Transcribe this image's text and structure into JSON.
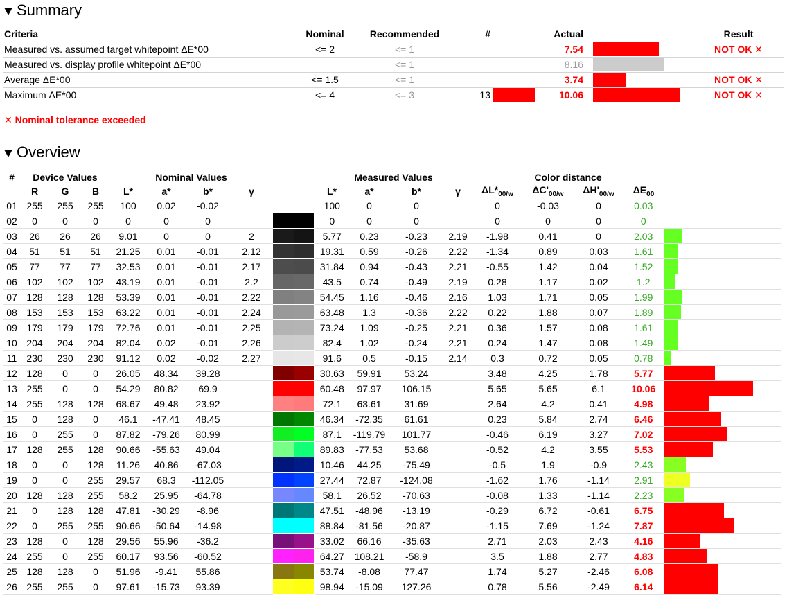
{
  "summary": {
    "title": "Summary",
    "headers": {
      "criteria": "Criteria",
      "nominal": "Nominal",
      "recommended": "Recommended",
      "count": "#",
      "actual": "Actual",
      "result": "Result"
    },
    "rows": [
      {
        "criteria": "Measured vs. assumed target whitepoint ΔE*00",
        "nominal": "<= 2",
        "recommended": "<= 1",
        "count": "",
        "count_bar": 0,
        "actual": "7.54",
        "actual_style": "red",
        "actual_bar": 0.75,
        "result": "NOT OK ✕"
      },
      {
        "criteria": "Measured vs. display profile whitepoint ΔE*00",
        "nominal": "",
        "recommended": "<= 1",
        "count": "",
        "count_bar": 0,
        "actual": "8.16",
        "actual_style": "grey",
        "actual_bar": 0.81,
        "result": ""
      },
      {
        "criteria": "Average ΔE*00",
        "nominal": "<= 1.5",
        "recommended": "<= 1",
        "count": "",
        "count_bar": 0,
        "actual": "3.74",
        "actual_style": "red",
        "actual_bar": 0.37,
        "result": "NOT OK ✕"
      },
      {
        "criteria": "Maximum ΔE*00",
        "nominal": "<= 4",
        "recommended": "<= 3",
        "count": "13",
        "count_bar": 1,
        "actual": "10.06",
        "actual_style": "red",
        "actual_bar": 1.0,
        "result": "NOT OK ✕"
      }
    ],
    "tolerance_message": "✕ Nominal tolerance exceeded"
  },
  "overview": {
    "title": "Overview",
    "group_headers": {
      "num": "#",
      "device": "Device Values",
      "nominal": "Nominal Values",
      "measured": "Measured Values",
      "distance": "Color distance"
    },
    "col_headers": {
      "R": "R",
      "G": "G",
      "B": "B",
      "L": "L*",
      "a": "a*",
      "b": "b*",
      "gamma": "γ",
      "mL": "L*",
      "ma": "a*",
      "mb": "b*",
      "mgamma": "γ",
      "dL": "ΔL*",
      "dC": "ΔC'",
      "dH": "ΔH'",
      "dE": "ΔE",
      "sub_w": "00/w",
      "sub_00": "00"
    },
    "rows": [
      {
        "n": "01",
        "R": "255",
        "G": "255",
        "B": "255",
        "L": "100",
        "a": "0.02",
        "b": "-0.02",
        "g": "",
        "nom": "#ffffff",
        "meas": "#ffffff",
        "mL": "100",
        "ma": "0",
        "mb": "0",
        "mg": "",
        "dL": "0",
        "dC": "-0.03",
        "dH": "0",
        "dE": "0.03",
        "bad": false,
        "bar": 0.003,
        "barcolor": "#66ff22"
      },
      {
        "n": "02",
        "R": "0",
        "G": "0",
        "B": "0",
        "L": "0",
        "a": "0",
        "b": "0",
        "g": "",
        "nom": "#000000",
        "meas": "#000000",
        "mL": "0",
        "ma": "0",
        "mb": "0",
        "mg": "",
        "dL": "0",
        "dC": "0",
        "dH": "0",
        "dE": "0",
        "bad": false,
        "bar": 0,
        "barcolor": "#66ff22"
      },
      {
        "n": "03",
        "R": "26",
        "G": "26",
        "B": "26",
        "L": "9.01",
        "a": "0",
        "b": "0",
        "g": "2",
        "nom": "#1a1a1a",
        "meas": "#141414",
        "mL": "5.77",
        "ma": "0.23",
        "mb": "-0.23",
        "mg": "2.19",
        "dL": "-1.98",
        "dC": "0.41",
        "dH": "0",
        "dE": "2.03",
        "bad": false,
        "bar": 0.2,
        "barcolor": "#66ff22"
      },
      {
        "n": "04",
        "R": "51",
        "G": "51",
        "B": "51",
        "L": "21.25",
        "a": "0.01",
        "b": "-0.01",
        "g": "2.12",
        "nom": "#333333",
        "meas": "#2e2e2e",
        "mL": "19.31",
        "ma": "0.59",
        "mb": "-0.26",
        "mg": "2.22",
        "dL": "-1.34",
        "dC": "0.89",
        "dH": "0.03",
        "dE": "1.61",
        "bad": false,
        "bar": 0.16,
        "barcolor": "#66ff22"
      },
      {
        "n": "05",
        "R": "77",
        "G": "77",
        "B": "77",
        "L": "32.53",
        "a": "0.01",
        "b": "-0.01",
        "g": "2.17",
        "nom": "#4d4d4d",
        "meas": "#4b4b4b",
        "mL": "31.84",
        "ma": "0.94",
        "mb": "-0.43",
        "mg": "2.21",
        "dL": "-0.55",
        "dC": "1.42",
        "dH": "0.04",
        "dE": "1.52",
        "bad": false,
        "bar": 0.15,
        "barcolor": "#66ff22"
      },
      {
        "n": "06",
        "R": "102",
        "G": "102",
        "B": "102",
        "L": "43.19",
        "a": "0.01",
        "b": "-0.01",
        "g": "2.2",
        "nom": "#666666",
        "meas": "#686868",
        "mL": "43.5",
        "ma": "0.74",
        "mb": "-0.49",
        "mg": "2.19",
        "dL": "0.28",
        "dC": "1.17",
        "dH": "0.02",
        "dE": "1.2",
        "bad": false,
        "bar": 0.12,
        "barcolor": "#66ff22"
      },
      {
        "n": "07",
        "R": "128",
        "G": "128",
        "B": "128",
        "L": "53.39",
        "a": "0.01",
        "b": "-0.01",
        "g": "2.22",
        "nom": "#808080",
        "meas": "#838383",
        "mL": "54.45",
        "ma": "1.16",
        "mb": "-0.46",
        "mg": "2.16",
        "dL": "1.03",
        "dC": "1.71",
        "dH": "0.05",
        "dE": "1.99",
        "bad": false,
        "bar": 0.2,
        "barcolor": "#66ff22"
      },
      {
        "n": "08",
        "R": "153",
        "G": "153",
        "B": "153",
        "L": "63.22",
        "a": "0.01",
        "b": "-0.01",
        "g": "2.24",
        "nom": "#999999",
        "meas": "#9a9a9a",
        "mL": "63.48",
        "ma": "1.3",
        "mb": "-0.36",
        "mg": "2.22",
        "dL": "0.22",
        "dC": "1.88",
        "dH": "0.07",
        "dE": "1.89",
        "bad": false,
        "bar": 0.19,
        "barcolor": "#66ff22"
      },
      {
        "n": "09",
        "R": "179",
        "G": "179",
        "B": "179",
        "L": "72.76",
        "a": "0.01",
        "b": "-0.01",
        "g": "2.25",
        "nom": "#b3b3b3",
        "meas": "#b4b4b4",
        "mL": "73.24",
        "ma": "1.09",
        "mb": "-0.25",
        "mg": "2.21",
        "dL": "0.36",
        "dC": "1.57",
        "dH": "0.08",
        "dE": "1.61",
        "bad": false,
        "bar": 0.16,
        "barcolor": "#66ff22"
      },
      {
        "n": "10",
        "R": "204",
        "G": "204",
        "B": "204",
        "L": "82.04",
        "a": "0.02",
        "b": "-0.01",
        "g": "2.26",
        "nom": "#cccccc",
        "meas": "#cdcdcd",
        "mL": "82.4",
        "ma": "1.02",
        "mb": "-0.24",
        "mg": "2.21",
        "dL": "0.24",
        "dC": "1.47",
        "dH": "0.08",
        "dE": "1.49",
        "bad": false,
        "bar": 0.15,
        "barcolor": "#66ff22"
      },
      {
        "n": "11",
        "R": "230",
        "G": "230",
        "B": "230",
        "L": "91.12",
        "a": "0.02",
        "b": "-0.02",
        "g": "2.27",
        "nom": "#e6e6e6",
        "meas": "#e7e7e7",
        "mL": "91.6",
        "ma": "0.5",
        "mb": "-0.15",
        "mg": "2.14",
        "dL": "0.3",
        "dC": "0.72",
        "dH": "0.05",
        "dE": "0.78",
        "bad": false,
        "bar": 0.08,
        "barcolor": "#66ff22"
      },
      {
        "n": "12",
        "R": "128",
        "G": "0",
        "B": "0",
        "L": "26.05",
        "a": "48.34",
        "b": "39.28",
        "g": "",
        "nom": "#800000",
        "meas": "#990000",
        "mL": "30.63",
        "ma": "59.91",
        "mb": "53.24",
        "mg": "",
        "dL": "3.48",
        "dC": "4.25",
        "dH": "1.78",
        "dE": "5.77",
        "bad": true,
        "bar": 0.57,
        "barcolor": "#ff0000"
      },
      {
        "n": "13",
        "R": "255",
        "G": "0",
        "B": "0",
        "L": "54.29",
        "a": "80.82",
        "b": "69.9",
        "g": "",
        "nom": "#ff0000",
        "meas": "#ff0000",
        "mL": "60.48",
        "ma": "97.97",
        "mb": "106.15",
        "mg": "",
        "dL": "5.65",
        "dC": "5.65",
        "dH": "6.1",
        "dE": "10.06",
        "bad": true,
        "bar": 1.0,
        "barcolor": "#ff0000"
      },
      {
        "n": "14",
        "R": "255",
        "G": "128",
        "B": "128",
        "L": "68.67",
        "a": "49.48",
        "b": "23.92",
        "g": "",
        "nom": "#ff8080",
        "meas": "#ff7a7a",
        "mL": "72.1",
        "ma": "63.61",
        "mb": "31.69",
        "mg": "",
        "dL": "2.64",
        "dC": "4.2",
        "dH": "0.41",
        "dE": "4.98",
        "bad": true,
        "bar": 0.5,
        "barcolor": "#ff0000"
      },
      {
        "n": "15",
        "R": "0",
        "G": "128",
        "B": "0",
        "L": "46.1",
        "a": "-47.41",
        "b": "48.45",
        "g": "",
        "nom": "#007700",
        "meas": "#008800",
        "mL": "46.34",
        "ma": "-72.35",
        "mb": "61.61",
        "mg": "",
        "dL": "0.23",
        "dC": "5.84",
        "dH": "2.74",
        "dE": "6.46",
        "bad": true,
        "bar": 0.64,
        "barcolor": "#ff0000"
      },
      {
        "n": "16",
        "R": "0",
        "G": "255",
        "B": "0",
        "L": "87.82",
        "a": "-79.26",
        "b": "80.99",
        "g": "",
        "nom": "#11ee22",
        "meas": "#00ff22",
        "mL": "87.1",
        "ma": "-119.79",
        "mb": "101.77",
        "mg": "",
        "dL": "-0.46",
        "dC": "6.19",
        "dH": "3.27",
        "dE": "7.02",
        "bad": true,
        "bar": 0.7,
        "barcolor": "#ff0000"
      },
      {
        "n": "17",
        "R": "128",
        "G": "255",
        "B": "128",
        "L": "90.66",
        "a": "-55.63",
        "b": "49.04",
        "g": "",
        "nom": "#77ff88",
        "meas": "#11ff77",
        "mL": "89.83",
        "ma": "-77.53",
        "mb": "53.68",
        "mg": "",
        "dL": "-0.52",
        "dC": "4.2",
        "dH": "3.55",
        "dE": "5.53",
        "bad": true,
        "bar": 0.55,
        "barcolor": "#ff0000"
      },
      {
        "n": "18",
        "R": "0",
        "G": "0",
        "B": "128",
        "L": "11.26",
        "a": "40.86",
        "b": "-67.03",
        "g": "",
        "nom": "#00167a",
        "meas": "#001a88",
        "mL": "10.46",
        "ma": "44.25",
        "mb": "-75.49",
        "mg": "",
        "dL": "-0.5",
        "dC": "1.9",
        "dH": "-0.9",
        "dE": "2.43",
        "bad": false,
        "bar": 0.24,
        "barcolor": "#88ff22"
      },
      {
        "n": "19",
        "R": "0",
        "G": "0",
        "B": "255",
        "L": "29.57",
        "a": "68.3",
        "b": "-112.05",
        "g": "",
        "nom": "#0033ff",
        "meas": "#0044ff",
        "mL": "27.44",
        "ma": "72.87",
        "mb": "-124.08",
        "mg": "",
        "dL": "-1.62",
        "dC": "1.76",
        "dH": "-1.14",
        "dE": "2.91",
        "bad": false,
        "bar": 0.29,
        "barcolor": "#eeff22"
      },
      {
        "n": "20",
        "R": "128",
        "G": "128",
        "B": "255",
        "L": "58.2",
        "a": "25.95",
        "b": "-64.78",
        "g": "",
        "nom": "#7788ff",
        "meas": "#6688ff",
        "mL": "58.1",
        "ma": "26.52",
        "mb": "-70.63",
        "mg": "",
        "dL": "-0.08",
        "dC": "1.33",
        "dH": "-1.14",
        "dE": "2.23",
        "bad": false,
        "bar": 0.22,
        "barcolor": "#88ff22"
      },
      {
        "n": "21",
        "R": "0",
        "G": "128",
        "B": "128",
        "L": "47.81",
        "a": "-30.29",
        "b": "-8.96",
        "g": "",
        "nom": "#007777",
        "meas": "#008888",
        "mL": "47.51",
        "ma": "-48.96",
        "mb": "-13.19",
        "mg": "",
        "dL": "-0.29",
        "dC": "6.72",
        "dH": "-0.61",
        "dE": "6.75",
        "bad": true,
        "bar": 0.67,
        "barcolor": "#ff0000"
      },
      {
        "n": "22",
        "R": "0",
        "G": "255",
        "B": "255",
        "L": "90.66",
        "a": "-50.64",
        "b": "-14.98",
        "g": "",
        "nom": "#00ffff",
        "meas": "#00ffff",
        "mL": "88.84",
        "ma": "-81.56",
        "mb": "-20.87",
        "mg": "",
        "dL": "-1.15",
        "dC": "7.69",
        "dH": "-1.24",
        "dE": "7.87",
        "bad": true,
        "bar": 0.78,
        "barcolor": "#ff0000"
      },
      {
        "n": "23",
        "R": "128",
        "G": "0",
        "B": "128",
        "L": "29.56",
        "a": "55.96",
        "b": "-36.2",
        "g": "",
        "nom": "#771177",
        "meas": "#991188",
        "mL": "33.02",
        "ma": "66.16",
        "mb": "-35.63",
        "mg": "",
        "dL": "2.71",
        "dC": "2.03",
        "dH": "2.43",
        "dE": "4.16",
        "bad": true,
        "bar": 0.41,
        "barcolor": "#ff0000"
      },
      {
        "n": "24",
        "R": "255",
        "G": "0",
        "B": "255",
        "L": "60.17",
        "a": "93.56",
        "b": "-60.52",
        "g": "",
        "nom": "#ff22ff",
        "meas": "#ff22ee",
        "mL": "64.27",
        "ma": "108.21",
        "mb": "-58.9",
        "mg": "",
        "dL": "3.5",
        "dC": "1.88",
        "dH": "2.77",
        "dE": "4.83",
        "bad": true,
        "bar": 0.48,
        "barcolor": "#ff0000"
      },
      {
        "n": "25",
        "R": "128",
        "G": "128",
        "B": "0",
        "L": "51.96",
        "a": "-9.41",
        "b": "55.86",
        "g": "",
        "nom": "#887711",
        "meas": "#888800",
        "mL": "53.74",
        "ma": "-8.08",
        "mb": "77.47",
        "mg": "",
        "dL": "1.74",
        "dC": "5.27",
        "dH": "-2.46",
        "dE": "6.08",
        "bad": true,
        "bar": 0.6,
        "barcolor": "#ff0000"
      },
      {
        "n": "26",
        "R": "255",
        "G": "255",
        "B": "0",
        "L": "97.61",
        "a": "-15.73",
        "b": "93.39",
        "g": "",
        "nom": "#ffff22",
        "meas": "#ffff11",
        "mL": "98.94",
        "ma": "-15.09",
        "mb": "127.26",
        "mg": "",
        "dL": "0.78",
        "dC": "5.56",
        "dH": "-2.49",
        "dE": "6.14",
        "bad": true,
        "bar": 0.61,
        "barcolor": "#ff0000"
      }
    ]
  }
}
